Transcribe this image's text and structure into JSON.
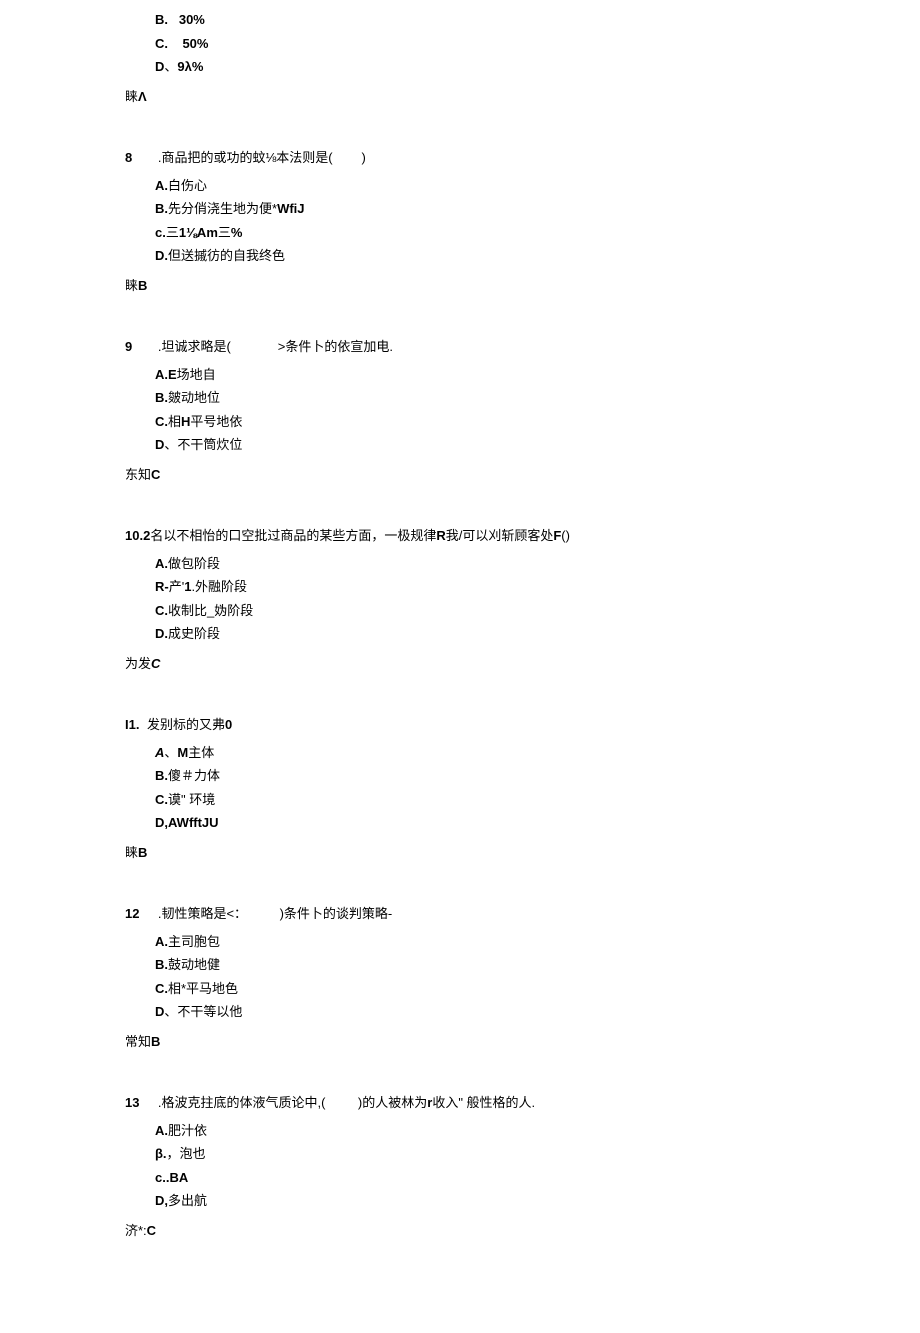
{
  "questions": [
    {
      "number": "",
      "stem_html": "",
      "options": [
        {
          "label": "B.",
          "sep": "   ",
          "text": "30%",
          "label_bold": true,
          "text_bold": true
        },
        {
          "label": "C.",
          "sep": "    ",
          "text": "50%",
          "label_bold": true,
          "text_bold": true
        },
        {
          "label": "D",
          "sep": "、",
          "text": "9λ%",
          "label_bold": true,
          "text_bold": true
        }
      ],
      "answer_prefix": "睐",
      "answer_value": "Λ"
    },
    {
      "number": "8",
      "stem_parts": [
        {
          "t": ".商品把的或功的蚊⅛本法则是(",
          "b": false
        },
        {
          "t": "        ",
          "b": false
        },
        {
          "t": ")",
          "b": false
        }
      ],
      "options": [
        {
          "label": "A.",
          "sep": "",
          "text": "白伤心",
          "label_bold": true,
          "text_bold": false
        },
        {
          "label": "B.",
          "sep": "",
          "text_parts": [
            {
              "t": "先分俏浇生地为便*",
              "b": false
            },
            {
              "t": "WfiJ",
              "b": true
            }
          ],
          "label_bold": true
        },
        {
          "label": "c.",
          "sep": "",
          "text_parts": [
            {
              "t": "三",
              "b": false
            },
            {
              "t": "1⅛Am",
              "b": true
            },
            {
              "t": "三",
              "b": false
            },
            {
              "t": "%",
              "b": true
            }
          ],
          "label_bold": true
        },
        {
          "label": "D.",
          "sep": "",
          "text": "但送摵彷的自我终色",
          "label_bold": true,
          "text_bold": false
        }
      ],
      "answer_prefix": "睐",
      "answer_value": "B"
    },
    {
      "number": "9",
      "stem_parts": [
        {
          "t": ".坦诚求略是(",
          "b": false
        },
        {
          "t": "             ",
          "b": false
        },
        {
          "t": ">条件卜的依宣加电.",
          "b": false
        }
      ],
      "options": [
        {
          "label": "A.E",
          "sep": "",
          "text": "场地自",
          "label_bold": true,
          "text_bold": false
        },
        {
          "label": "B.",
          "sep": "",
          "text": "皴动地位",
          "label_bold": true,
          "text_bold": false
        },
        {
          "label": "C.",
          "sep": "",
          "text_parts": [
            {
              "t": "相",
              "b": false
            },
            {
              "t": "H",
              "b": true
            },
            {
              "t": "平号地依",
              "b": false
            }
          ],
          "label_bold": true
        },
        {
          "label": "D",
          "sep": "、",
          "text": "不干筒炊位",
          "label_bold": true,
          "text_bold": false
        }
      ],
      "answer_prefix": "东知",
      "answer_value": "C"
    },
    {
      "number": "10.2",
      "number_bold": true,
      "stem_parts": [
        {
          "t": "名以不相怡的口空批过商品的某些方面，一极规律",
          "b": false
        },
        {
          "t": "R",
          "b": true
        },
        {
          "t": "我/可以刈斩顾客处",
          "b": false
        },
        {
          "t": "F",
          "b": true
        },
        {
          "t": "()",
          "b": false
        }
      ],
      "no_num_gap": true,
      "options": [
        {
          "label": "A.",
          "sep": "",
          "text": "做包阶段",
          "label_bold": true,
          "text_bold": false
        },
        {
          "label": "R-",
          "sep": "",
          "text_parts": [
            {
              "t": "产'",
              "b": false
            },
            {
              "t": "1",
              "b": true
            },
            {
              "t": ".外融阶段",
              "b": false
            }
          ],
          "label_bold": true
        },
        {
          "label": "C.",
          "sep": "",
          "text": "收制比_妫阶段",
          "label_bold": true,
          "text_bold": false
        },
        {
          "label": "D.",
          "sep": "",
          "text": "成史阶段",
          "label_bold": true,
          "text_bold": false
        }
      ],
      "answer_prefix": "为发",
      "answer_value": "C",
      "answer_italic": true
    },
    {
      "number": "I1.",
      "number_bold": true,
      "stem_parts": [
        {
          "t": "发别标的又弗",
          "b": false
        },
        {
          "t": "0",
          "b": true
        }
      ],
      "no_num_gap": true,
      "options": [
        {
          "label": "A",
          "sep": "、",
          "text_parts": [
            {
              "t": "M",
              "b": true
            },
            {
              "t": "主体",
              "b": false
            }
          ],
          "label_italic": true
        },
        {
          "label": "B.",
          "sep": "",
          "text": "傻＃力体",
          "label_bold": true,
          "text_bold": false
        },
        {
          "label": "C.",
          "sep": "",
          "text": "谟\" 环境",
          "label_bold": true,
          "text_bold": false
        },
        {
          "label": "D,AWfftJU",
          "sep": "",
          "text": "",
          "label_bold": true,
          "text_bold": false
        }
      ],
      "answer_prefix": "睐",
      "answer_value": "B"
    },
    {
      "number": "12",
      "stem_parts": [
        {
          "t": ".韧性策略是<：",
          "b": false
        },
        {
          "t": "         ",
          "b": false
        },
        {
          "t": ")条件卜的谈判策略-",
          "b": false
        }
      ],
      "options": [
        {
          "label": "A.",
          "sep": "",
          "text": "主司胞包",
          "label_bold": true,
          "text_bold": false
        },
        {
          "label": "B.",
          "sep": "",
          "text": "鼓动地健",
          "label_bold": true,
          "text_bold": false
        },
        {
          "label": "C.",
          "sep": "",
          "text": "相*平马地色",
          "label_bold": true,
          "text_bold": false
        },
        {
          "label": "D",
          "sep": "、",
          "text": "不干等以他",
          "label_bold": true,
          "text_bold": false
        }
      ],
      "answer_prefix": "常知",
      "answer_value": "B"
    },
    {
      "number": "13",
      "stem_parts": [
        {
          "t": ".格波克拄底的体液气质论中,(",
          "b": false
        },
        {
          "t": "         ",
          "b": false
        },
        {
          "t": ")的人被林为",
          "b": false
        },
        {
          "t": "r",
          "b": true
        },
        {
          "t": "收入\" 般性格的人.",
          "b": false
        }
      ],
      "options": [
        {
          "label": "A.",
          "sep": "",
          "text": "肥汁依",
          "label_bold": true,
          "text_bold": false
        },
        {
          "label": "β.",
          "sep": "",
          "text": "，泡也",
          "label_bold": true,
          "text_bold": false
        },
        {
          "label": "c..BA",
          "sep": "",
          "text": "",
          "label_bold": true,
          "text_bold": false
        },
        {
          "label": "D,",
          "sep": "",
          "text": "多出航",
          "label_bold": true,
          "text_bold": false
        }
      ],
      "answer_prefix": "济*:",
      "answer_value": "C"
    }
  ]
}
